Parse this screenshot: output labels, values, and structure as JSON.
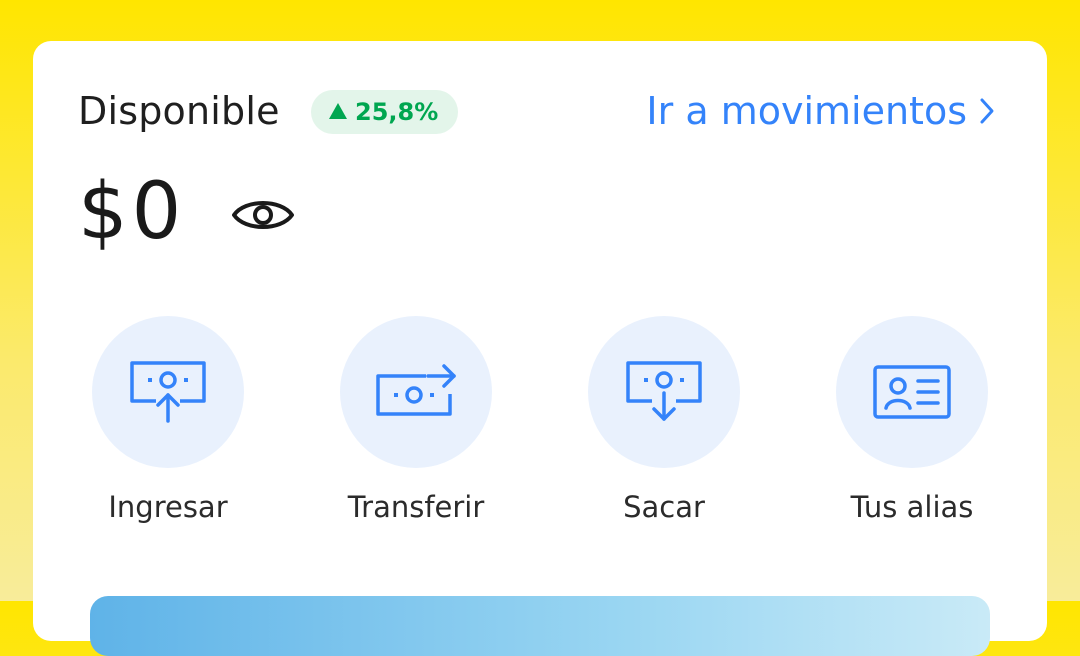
{
  "card": {
    "title": "Disponible",
    "badge": {
      "value": "25,8%",
      "direction": "up",
      "color": "#00A650"
    },
    "movements_link": "Ir a movimientos",
    "balance": "$0",
    "accent_color": "#3483FA"
  },
  "actions": [
    {
      "label": "Ingresar",
      "icon": "money-in-icon"
    },
    {
      "label": "Transferir",
      "icon": "money-transfer-icon"
    },
    {
      "label": "Sacar",
      "icon": "money-out-icon"
    },
    {
      "label": "Tus alias",
      "icon": "id-card-icon"
    }
  ]
}
